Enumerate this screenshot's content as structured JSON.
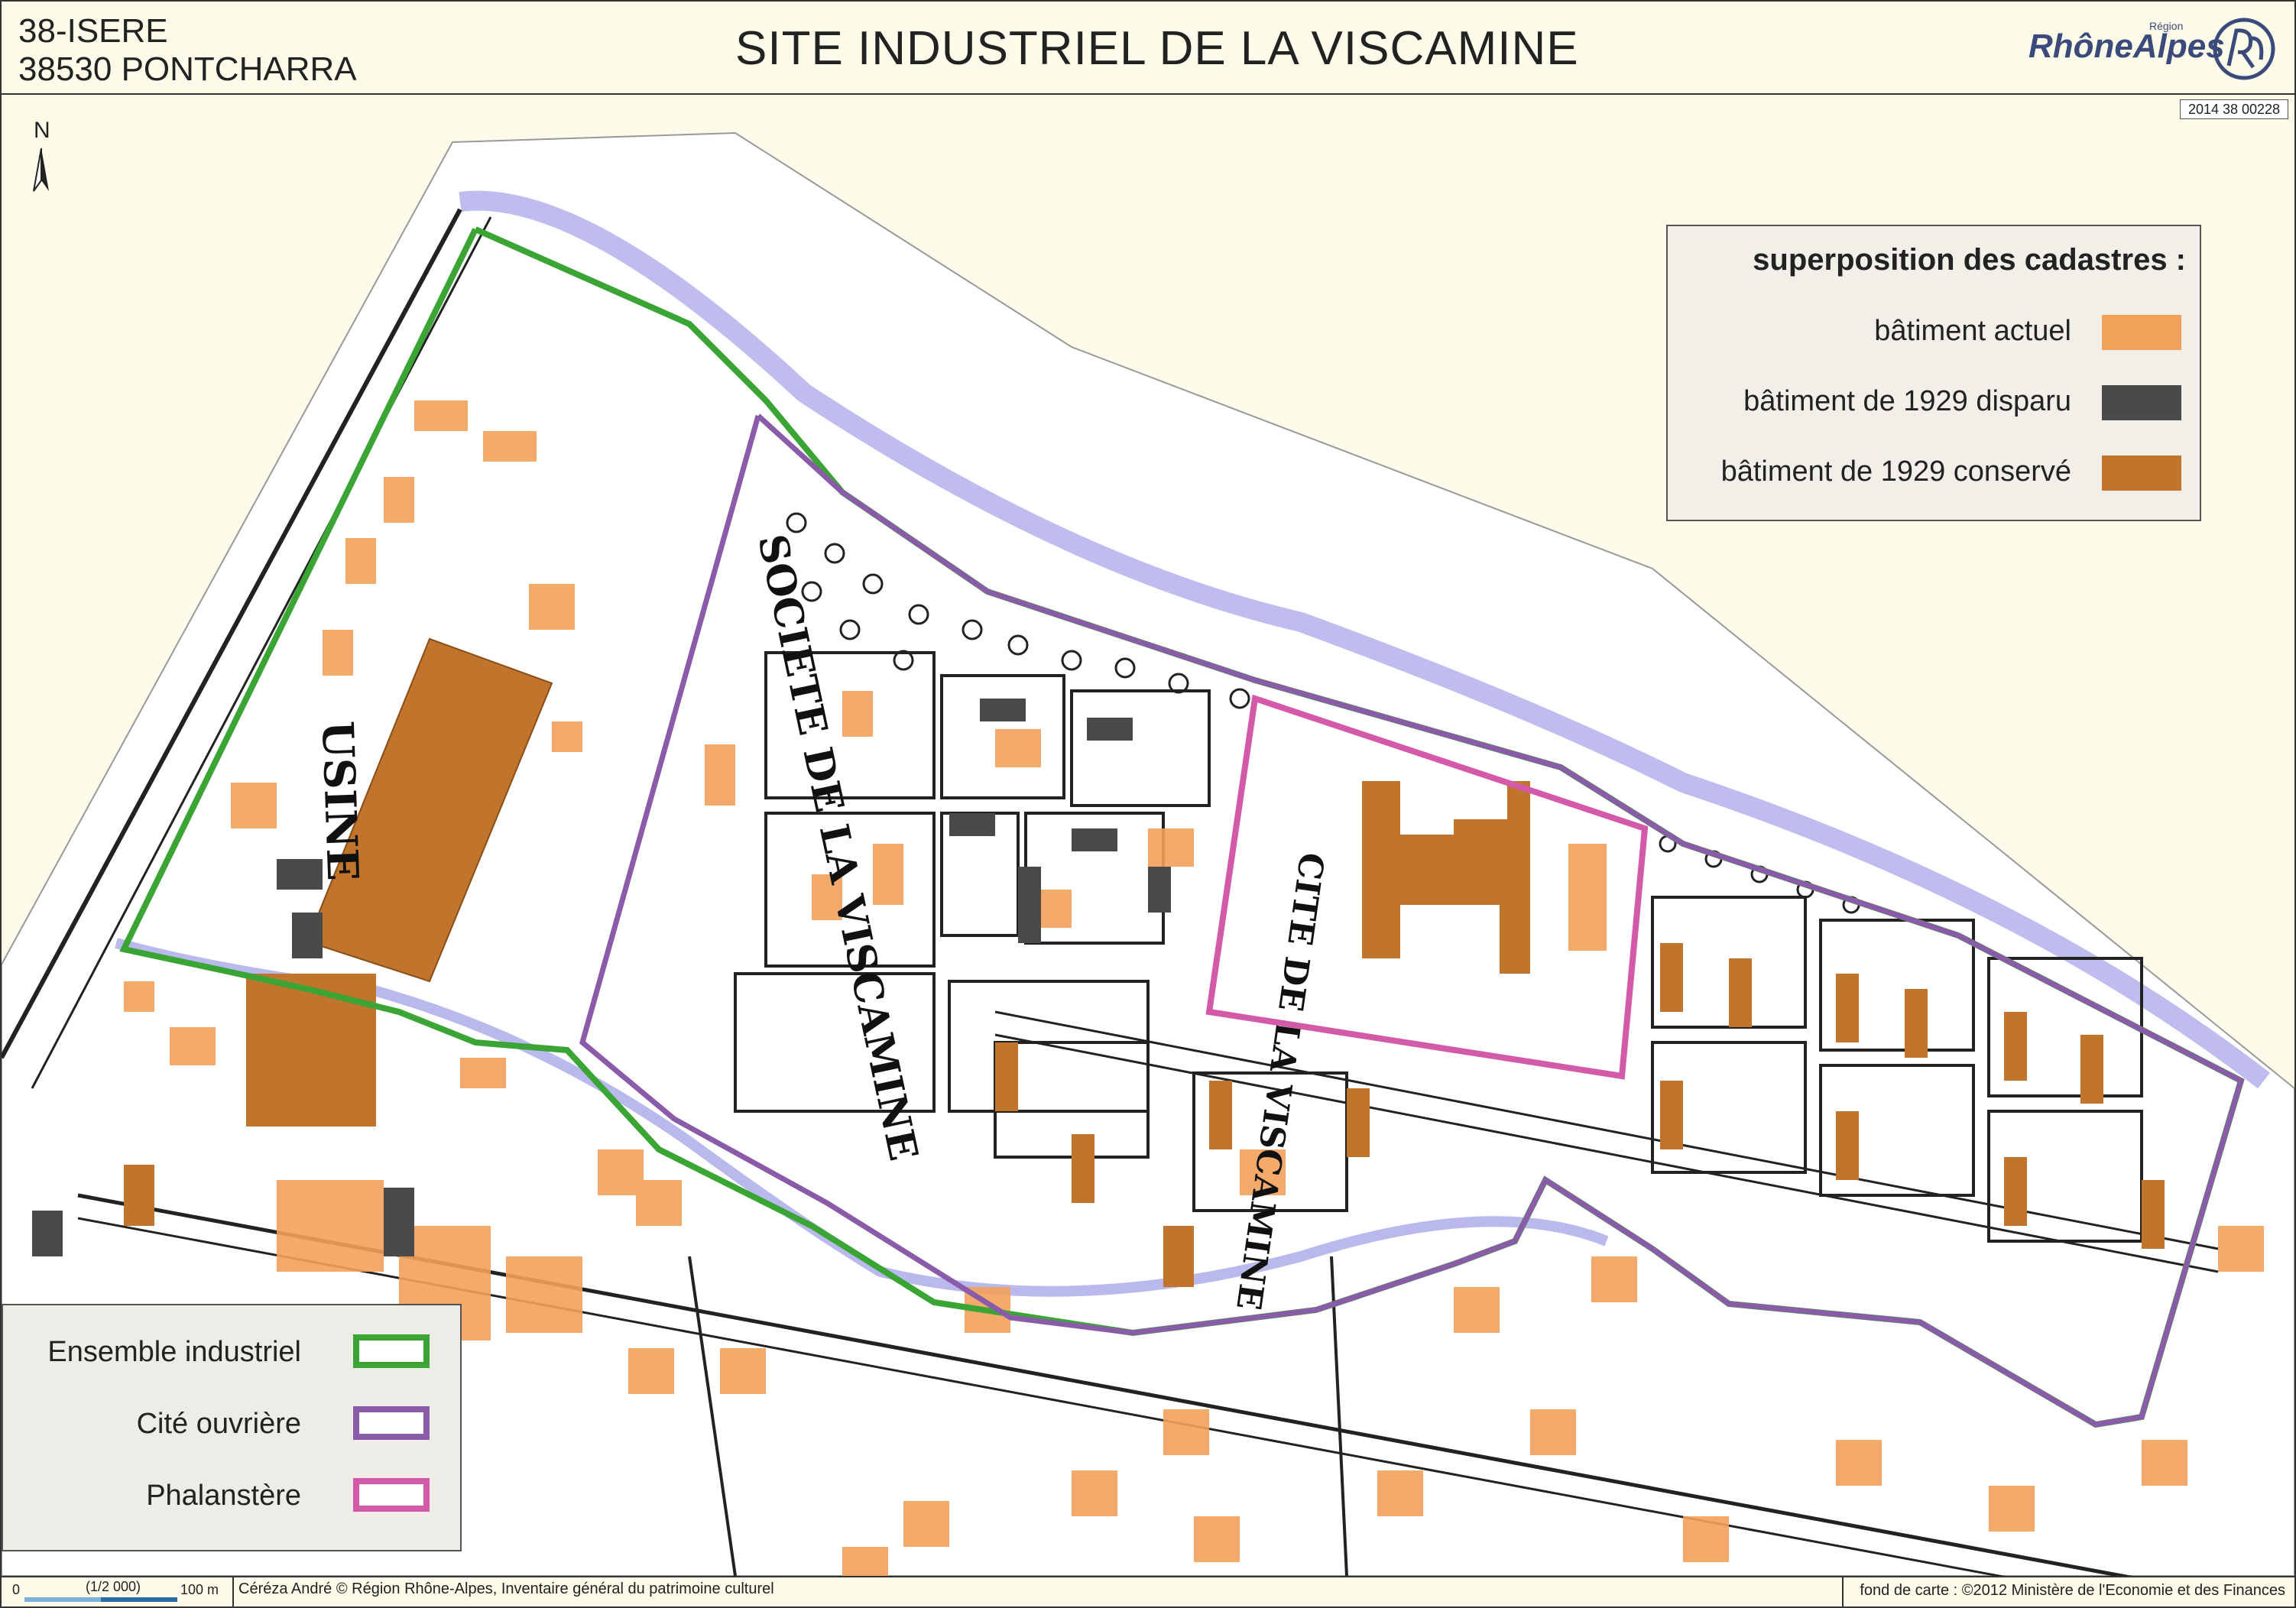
{
  "header": {
    "location_line1": "38-ISERE",
    "location_line2": "38530 PONTCHARRA",
    "title": "SITE INDUSTRIEL DE LA VISCAMINE",
    "logo_text": "RhôneAlpes",
    "logo_region": "Région",
    "reference": "2014 38 00228"
  },
  "north_arrow": {
    "label": "N"
  },
  "legend_buildings": {
    "title": "superposition des cadastres :",
    "items": [
      {
        "label": "bâtiment actuel",
        "color": "#f2a15a"
      },
      {
        "label": "bâtiment de 1929 disparu",
        "color": "#4a4a4a"
      },
      {
        "label": "bâtiment de 1929 conservé",
        "color": "#c0742c"
      }
    ]
  },
  "legend_zones": {
    "items": [
      {
        "label": "Ensemble industriel",
        "color": "#3aa534"
      },
      {
        "label": "Cité ouvrière",
        "color": "#8a5ba8"
      },
      {
        "label": "Phalanstère",
        "color": "#d25aa8"
      }
    ]
  },
  "map_labels": {
    "usine": "USINE",
    "societe": "SOCIETE DE LA VISCAMINE",
    "cite": "CITE DE LA VISCAMINE"
  },
  "scale_bar": {
    "start": "0",
    "ratio": "(1/2 000)",
    "end": "100 m"
  },
  "footer": {
    "credit_left": "Céréza André © Région Rhône-Alpes, Inventaire général du patrimoine culturel",
    "credit_right": "fond de carte : ©2012 Ministère de l'Economie et des Finances"
  },
  "colors": {
    "background": "#fdfbe9",
    "map_paper": "#ffffff",
    "river": "#9a98e0",
    "ink": "#1a1a1a"
  }
}
